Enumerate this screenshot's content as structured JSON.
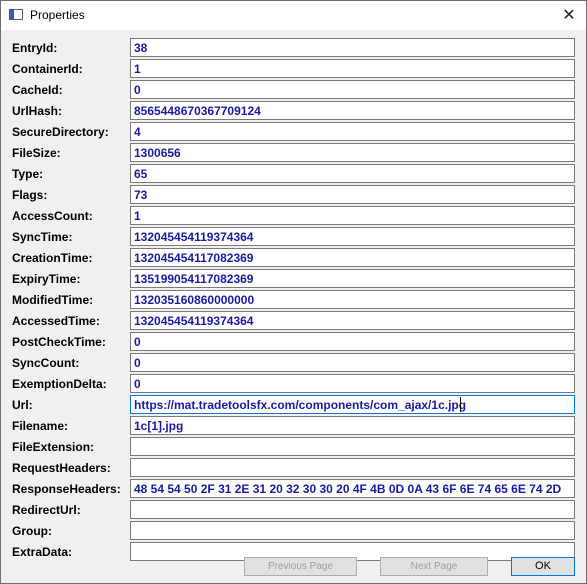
{
  "window": {
    "title": "Properties",
    "close_glyph": "✕"
  },
  "fields": [
    {
      "label": "EntryId:",
      "value": "38"
    },
    {
      "label": "ContainerId:",
      "value": "1"
    },
    {
      "label": "CacheId:",
      "value": "0"
    },
    {
      "label": "UrlHash:",
      "value": "8565448670367709124"
    },
    {
      "label": "SecureDirectory:",
      "value": "4"
    },
    {
      "label": "FileSize:",
      "value": "1300656"
    },
    {
      "label": "Type:",
      "value": "65"
    },
    {
      "label": "Flags:",
      "value": "73"
    },
    {
      "label": "AccessCount:",
      "value": "1"
    },
    {
      "label": "SyncTime:",
      "value": "132045454119374364"
    },
    {
      "label": "CreationTime:",
      "value": "132045454117082369"
    },
    {
      "label": "ExpiryTime:",
      "value": "135199054117082369"
    },
    {
      "label": "ModifiedTime:",
      "value": "132035160860000000"
    },
    {
      "label": "AccessedTime:",
      "value": "132045454119374364"
    },
    {
      "label": "PostCheckTime:",
      "value": "0"
    },
    {
      "label": "SyncCount:",
      "value": "0"
    },
    {
      "label": "ExemptionDelta:",
      "value": "0"
    },
    {
      "label": "Url:",
      "value": "https://mat.tradetoolsfx.com/components/com_ajax/1c.jpg"
    },
    {
      "label": "Filename:",
      "value": "1c[1].jpg"
    },
    {
      "label": "FileExtension:",
      "value": ""
    },
    {
      "label": "RequestHeaders:",
      "value": ""
    },
    {
      "label": "ResponseHeaders:",
      "value": "48 54 54 50 2F 31 2E 31 20 32 30 30 20 4F 4B 0D 0A 43 6F 6E 74 65 6E 74 2D"
    },
    {
      "label": "RedirectUrl:",
      "value": ""
    },
    {
      "label": "Group:",
      "value": ""
    },
    {
      "label": "ExtraData:",
      "value": ""
    }
  ],
  "buttons": {
    "previous": "Previous Page",
    "next": "Next Page",
    "ok": "OK"
  },
  "colors": {
    "value_text": "#1a1aa6",
    "focus_border": "#0078d7"
  }
}
